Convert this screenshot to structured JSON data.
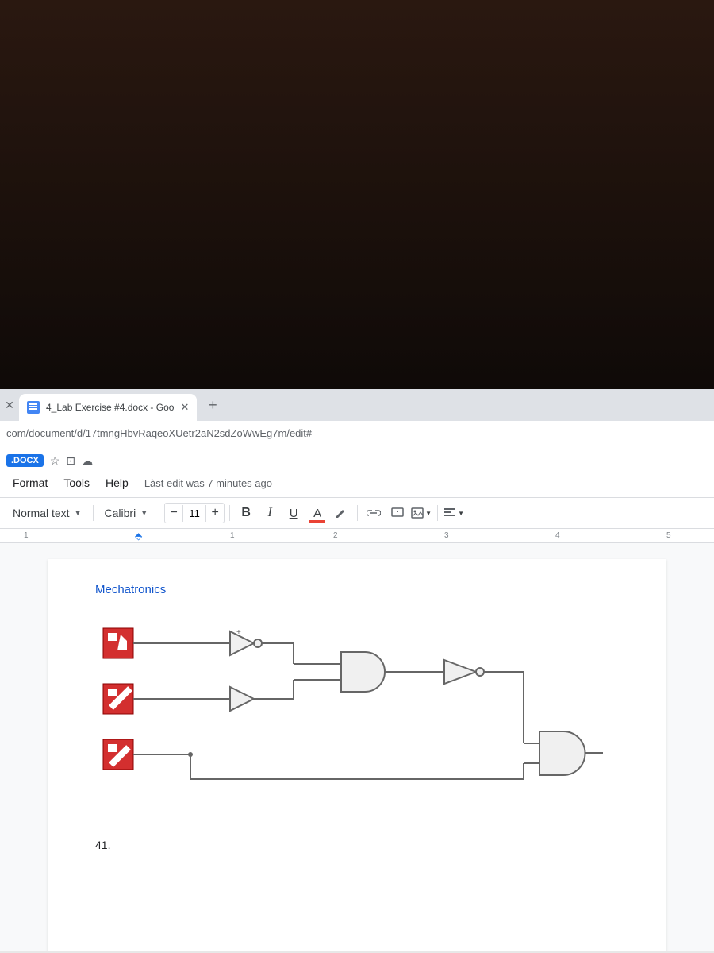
{
  "browser": {
    "tab_title": "4_Lab Exercise #4.docx - Goo",
    "url": "com/document/d/17tmngHbvRaqeoXUetr2aN2sdZoWwEg7m/edit#"
  },
  "docs": {
    "badge": ".DOCX",
    "menus": {
      "format": "Format",
      "tools": "Tools",
      "help": "Help"
    },
    "last_edit": "Làst edit was 7 minutes ago"
  },
  "toolbar": {
    "style": "Normal text",
    "font": "Calibri",
    "size": "11",
    "bold": "B",
    "italic": "I",
    "underline": "U",
    "color": "A"
  },
  "ruler": {
    "m1": "1",
    "m2": "1",
    "m3": "2",
    "m4": "3",
    "m5": "4",
    "m6": "5"
  },
  "document": {
    "heading": "Mechatronics",
    "list_number": "41."
  }
}
